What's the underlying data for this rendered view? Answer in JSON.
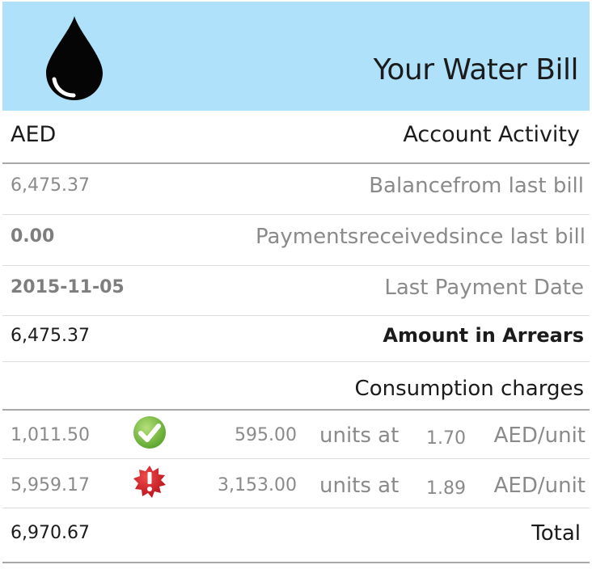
{
  "header": {
    "title": "Your Water Bill",
    "icon": "water-drop-icon",
    "background": "#b0e1fb"
  },
  "activity": {
    "currency": "AED",
    "heading": "Account Activity",
    "balance": {
      "value": "6,475.37",
      "label": "Balancefrom last bill"
    },
    "payments": {
      "value": "0.00",
      "label": "Paymentsreceivedsince last bill"
    },
    "last_payment": {
      "value": "2015-11-05",
      "label": "Last Payment Date"
    },
    "arrears": {
      "value": "6,475.37",
      "label": "Amount in Arrears"
    }
  },
  "consumption": {
    "heading": "Consumption charges",
    "tiers": [
      {
        "amount": "1,011.50",
        "status_icon": "check-circle-icon",
        "status_color": "#7dc243",
        "units": "595.00",
        "units_label": "units at",
        "rate": "1.70",
        "rate_unit": "AED/unit"
      },
      {
        "amount": "5,959.17",
        "status_icon": "alert-badge-icon",
        "status_color": "#d9202a",
        "units": "3,153.00",
        "units_label": "units at",
        "rate": "1.89",
        "rate_unit": "AED/unit"
      }
    ],
    "total": {
      "value": "6,970.67",
      "label": "Total"
    }
  }
}
